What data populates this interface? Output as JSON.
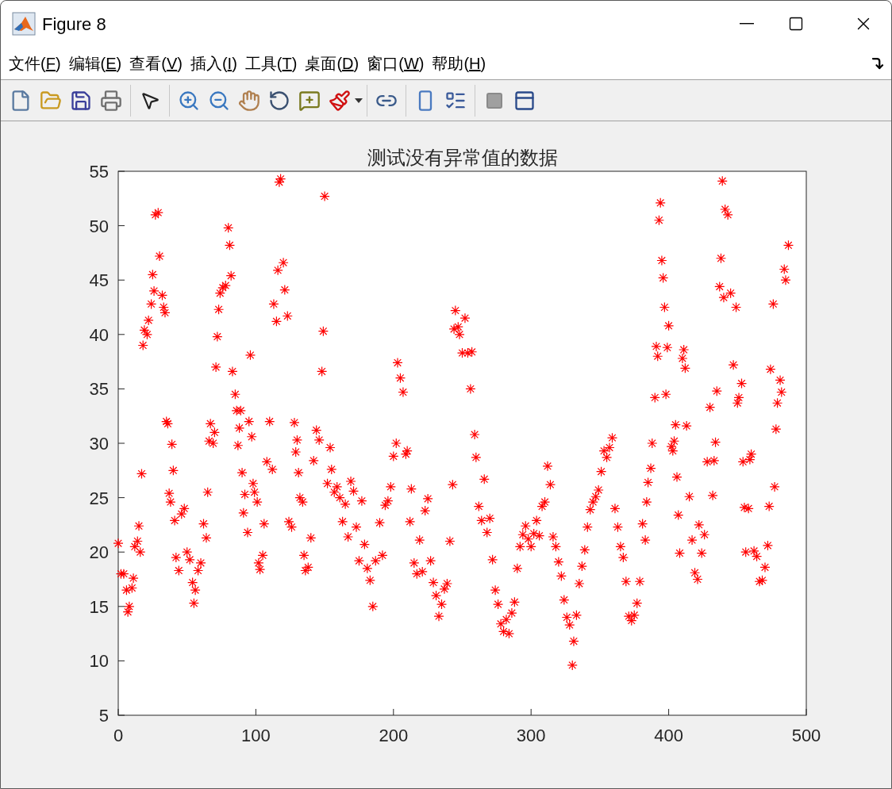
{
  "window": {
    "title": "Figure 8"
  },
  "menu": [
    "文件(F)",
    "编辑(E)",
    "查看(V)",
    "插入(I)",
    "工具(T)",
    "桌面(D)",
    "窗口(W)",
    "帮助(H)"
  ],
  "axes": {
    "chart_data": {
      "type": "scatter",
      "title": "测试没有异常值的数据",
      "xlim": [
        0,
        500
      ],
      "ylim": [
        5,
        55
      ],
      "xticks": [
        0,
        100,
        200,
        300,
        400,
        500
      ],
      "yticks": [
        5,
        10,
        15,
        20,
        25,
        30,
        35,
        40,
        45,
        50,
        55
      ],
      "x": [
        0,
        2,
        4,
        6,
        7,
        8,
        10,
        11,
        12,
        14,
        15,
        16,
        17,
        18,
        19,
        21,
        22,
        24,
        25,
        26,
        27,
        29,
        30,
        32,
        33,
        34,
        35,
        36,
        37,
        38,
        39,
        40,
        41,
        42,
        44,
        46,
        48,
        50,
        52,
        54,
        55,
        56,
        58,
        60,
        62,
        64,
        65,
        66,
        67,
        69,
        70,
        71,
        72,
        73,
        74,
        76,
        78,
        80,
        81,
        82,
        83,
        85,
        86,
        87,
        88,
        89,
        90,
        91,
        92,
        94,
        95,
        96,
        97,
        98,
        99,
        101,
        102,
        103,
        105,
        106,
        108,
        110,
        112,
        113,
        115,
        116,
        117,
        118,
        120,
        121,
        123,
        124,
        126,
        128,
        129,
        130,
        131,
        132,
        134,
        135,
        136,
        138,
        140,
        142,
        144,
        146,
        148,
        149,
        150,
        152,
        154,
        155,
        157,
        159,
        161,
        163,
        165,
        167,
        169,
        171,
        173,
        175,
        177,
        179,
        181,
        183,
        185,
        187,
        190,
        192,
        194,
        196,
        198,
        200,
        202,
        203,
        205,
        207,
        209,
        210,
        212,
        213,
        215,
        217,
        219,
        221,
        223,
        225,
        227,
        229,
        231,
        233,
        235,
        237,
        239,
        241,
        243,
        244,
        245,
        247,
        248,
        250,
        252,
        254,
        256,
        257,
        259,
        260,
        262,
        264,
        266,
        268,
        270,
        272,
        274,
        276,
        278,
        280,
        282,
        284,
        286,
        288,
        290,
        292,
        294,
        296,
        298,
        300,
        302,
        304,
        306,
        308,
        310,
        312,
        314,
        316,
        318,
        320,
        322,
        324,
        326,
        328,
        330,
        331,
        333,
        335,
        337,
        339,
        341,
        343,
        345,
        347,
        349,
        351,
        353,
        355,
        357,
        359,
        361,
        363,
        365,
        367,
        369,
        371,
        373,
        375,
        377,
        379,
        381,
        383,
        384,
        385,
        387,
        388,
        390,
        391,
        392,
        393,
        394,
        395,
        396,
        397,
        398,
        399,
        400,
        402,
        403,
        404,
        405,
        406,
        407,
        408,
        410,
        411,
        412,
        413,
        415,
        417,
        419,
        421,
        422,
        424,
        426,
        428,
        430,
        432,
        433,
        434,
        435,
        437,
        438,
        439,
        440,
        441,
        443,
        445,
        447,
        449,
        450,
        451,
        453,
        454,
        455,
        456,
        458,
        459,
        460,
        462,
        464,
        466,
        468,
        470,
        472,
        473,
        474,
        476,
        477,
        478,
        479,
        481,
        482,
        484,
        485,
        487
      ],
      "series": [
        {
          "color": "#ff0000",
          "values": [
            20.8,
            18,
            18,
            16.5,
            14.5,
            15,
            16.7,
            17.6,
            20.5,
            21,
            22.4,
            20,
            27.2,
            39,
            40.4,
            40,
            41.3,
            42.8,
            45.5,
            44,
            51,
            51.2,
            47.2,
            43.6,
            42.5,
            42,
            32,
            31.8,
            25.4,
            24.6,
            29.9,
            27.5,
            22.9,
            19.5,
            18.3,
            23.5,
            24,
            20,
            19.3,
            17.2,
            15.3,
            16.5,
            18.3,
            19,
            22.6,
            21.3,
            25.5,
            30.2,
            31.8,
            30,
            31,
            37,
            39.8,
            42.3,
            43.8,
            44.3,
            44.5,
            49.8,
            48.2,
            45.4,
            36.6,
            34.5,
            33,
            29.8,
            31.4,
            33,
            27.3,
            23.6,
            25.3,
            21.8,
            32,
            38.1,
            30.6,
            26.3,
            25.5,
            24.6,
            19,
            18.4,
            19.7,
            22.6,
            28.3,
            32,
            27.6,
            42.8,
            41.2,
            45.9,
            54,
            54.3,
            46.6,
            44.1,
            41.7,
            22.8,
            22.3,
            31.9,
            29.2,
            30.3,
            27.3,
            25,
            24.6,
            19.7,
            18.3,
            18.6,
            21.3,
            28.4,
            31.2,
            30.3,
            36.6,
            40.3,
            52.7,
            26.3,
            29.6,
            27.6,
            25.5,
            26,
            25,
            22.8,
            24.4,
            21.4,
            26.5,
            25.6,
            22.3,
            19.2,
            24.7,
            20.7,
            18.5,
            17.4,
            15,
            19.2,
            22.7,
            19.7,
            24.3,
            24.7,
            26,
            28.8,
            30,
            37.4,
            36,
            34.7,
            29,
            29.3,
            22.8,
            25.8,
            19,
            18,
            21.1,
            18.2,
            23.8,
            24.9,
            19.2,
            17.2,
            16,
            14.1,
            15.2,
            16.6,
            17.1,
            21,
            26.2,
            40.5,
            42.2,
            40.7,
            40,
            38.3,
            41.5,
            38.3,
            35,
            38.4,
            30.8,
            28.7,
            24.2,
            22.9,
            26.7,
            21.8,
            23.1,
            19.3,
            16.5,
            15.2,
            13.4,
            12.7,
            13.8,
            12.5,
            14.4,
            15.4,
            18.5,
            20.5,
            21.6,
            22.4,
            21.2,
            20.5,
            21.7,
            22.9,
            21.5,
            24.2,
            24.6,
            27.9,
            26.2,
            21.4,
            20.5,
            19.1,
            17.8,
            15.6,
            14,
            13.3,
            9.6,
            11.8,
            14.2,
            17.1,
            18.7,
            20.2,
            22.3,
            23.9,
            24.6,
            25.1,
            25.7,
            27.4,
            29.3,
            28.7,
            29.6,
            30.5,
            24,
            22.3,
            20.5,
            19.5,
            17.3,
            14.1,
            13.7,
            14.2,
            15.3,
            17.3,
            22.6,
            21.1,
            24.6,
            26.4,
            27.7,
            30,
            34.2,
            38.9,
            38,
            50.5,
            52.1,
            46.8,
            45.2,
            42.5,
            34.5,
            38.8,
            40.8,
            29.7,
            29.3,
            30.2,
            31.7,
            26.9,
            23.4,
            19.9,
            37.8,
            38.6,
            36.9,
            31.6,
            25.1,
            21.1,
            18.1,
            17.5,
            22.5,
            19.9,
            21.6,
            28.3,
            33.3,
            25.2,
            28.4,
            30.1,
            34.8,
            44.4,
            47,
            54.1,
            43.4,
            51.5,
            51,
            43.8,
            37.2,
            42.5,
            33.7,
            34.2,
            35.5,
            28.3,
            24.1,
            20,
            24,
            28.5,
            29,
            20.1,
            19.6,
            17.3,
            17.4,
            18.6,
            20.6,
            24.2,
            36.8,
            42.8,
            26,
            31.3,
            33.7,
            35.8,
            34.7,
            46,
            45,
            48.2
          ]
        }
      ]
    }
  }
}
